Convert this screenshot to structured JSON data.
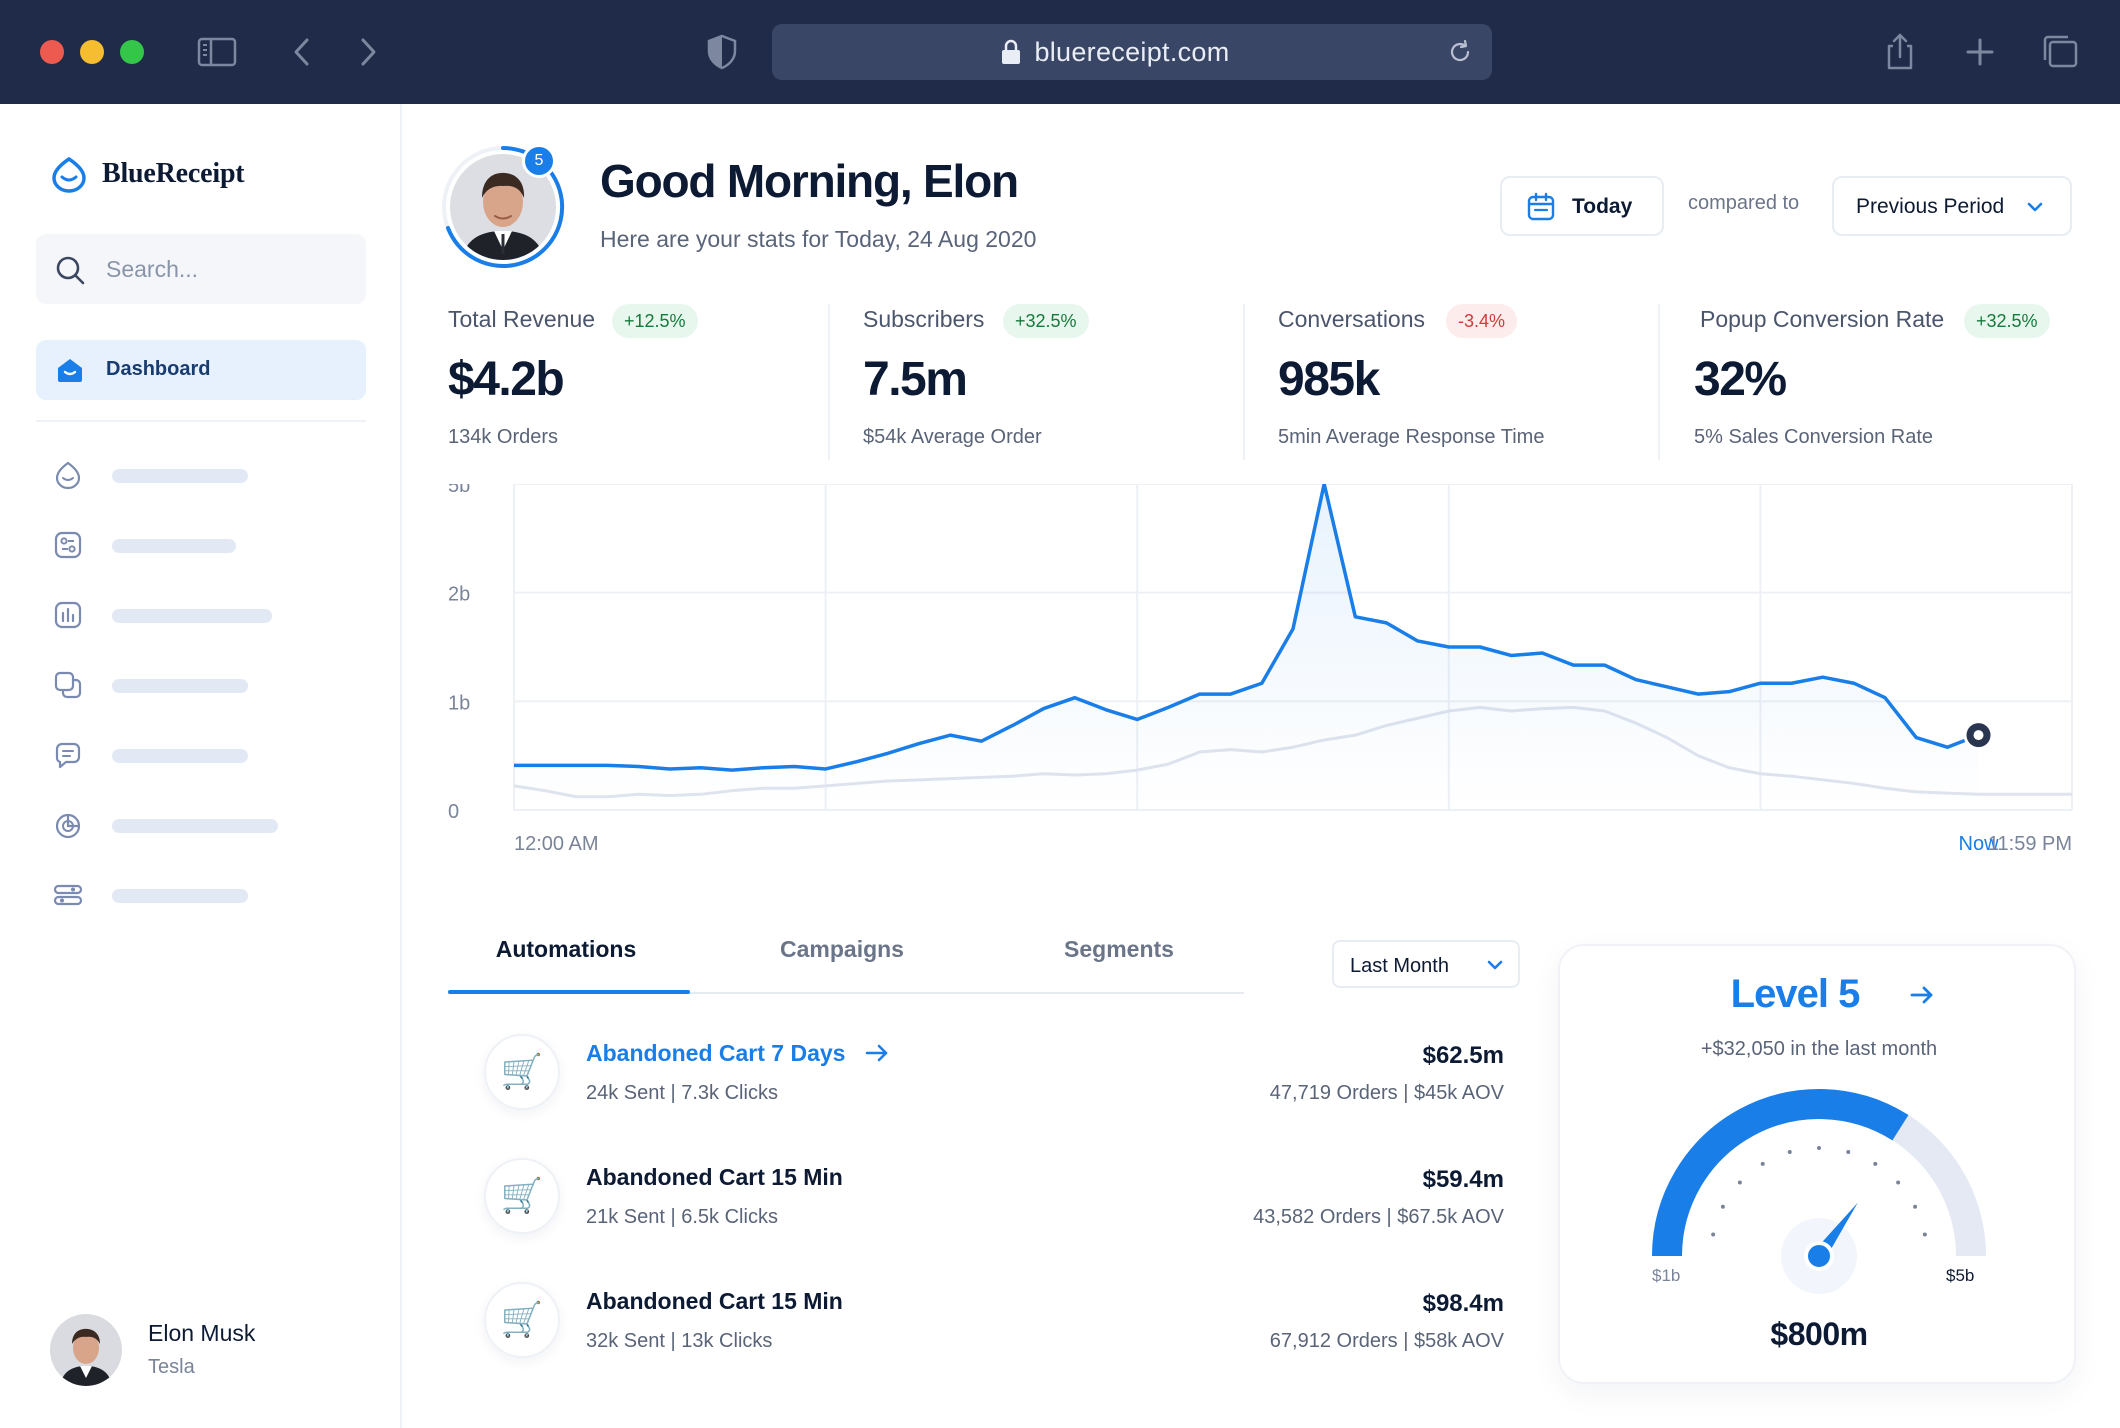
{
  "browser": {
    "url": "bluereceipt.com"
  },
  "brand": {
    "name": "BlueReceipt",
    "accent": "#1a7ee8"
  },
  "sidebar": {
    "search_placeholder": "Search...",
    "active_item": "Dashboard",
    "placeholder_items": [
      {
        "icon": "drop-icon"
      },
      {
        "icon": "apps-icon"
      },
      {
        "icon": "bar-chart-icon"
      },
      {
        "icon": "copy-icon"
      },
      {
        "icon": "message-icon"
      },
      {
        "icon": "pie-chart-icon"
      },
      {
        "icon": "sliders-icon"
      }
    ],
    "profile": {
      "name": "Elon Musk",
      "company": "Tesla"
    }
  },
  "header": {
    "greeting": "Good Morning, Elon",
    "subtitle": "Here are your stats for Today, 24 Aug 2020",
    "notification_count": "5",
    "today_label": "Today",
    "compared_to": "compared to",
    "period": "Previous Period"
  },
  "stats": [
    {
      "label": "Total Revenue",
      "change": "+12.5%",
      "trend": "up",
      "value": "$4.2b",
      "sub": "134k Orders"
    },
    {
      "label": "Subscribers",
      "change": "+32.5%",
      "trend": "up",
      "value": "7.5m",
      "sub": "$54k Average Order"
    },
    {
      "label": "Conversations",
      "change": "-3.4%",
      "trend": "down",
      "value": "985k",
      "sub": "5min Average Response Time"
    },
    {
      "label": "Popup Conversion Rate",
      "change": "+32.5%",
      "trend": "up",
      "value": "32%",
      "sub": "5% Sales Conversion Rate"
    }
  ],
  "chart_data": {
    "type": "line",
    "y_ticks": [
      "5b",
      "2b",
      "1b",
      "0"
    ],
    "x_ticks": [
      "12:00 AM",
      "Now",
      "11:59 PM"
    ],
    "grid": true,
    "x": [
      0,
      1,
      2,
      3,
      4,
      5,
      6,
      7,
      8,
      9,
      10,
      11,
      12,
      13,
      14,
      15,
      16,
      17,
      18,
      19,
      20,
      21,
      22,
      23,
      24,
      25,
      26,
      27,
      28,
      29,
      30,
      31,
      32,
      33,
      34,
      35,
      36,
      37,
      38,
      39,
      40,
      41,
      42,
      43,
      44,
      45,
      46,
      47,
      48,
      49,
      50
    ],
    "series": [
      {
        "role": "current",
        "color": "#1a7ee8",
        "values": [
          0.37,
          0.37,
          0.37,
          0.37,
          0.36,
          0.34,
          0.35,
          0.33,
          0.35,
          0.36,
          0.34,
          0.4,
          0.47,
          0.55,
          0.62,
          0.57,
          0.7,
          0.84,
          0.93,
          0.83,
          0.75,
          0.85,
          0.96,
          0.96,
          1.05,
          1.5,
          2.7,
          1.6,
          1.55,
          1.4,
          1.35,
          1.35,
          1.28,
          1.3,
          1.2,
          1.2,
          1.08,
          1.02,
          0.96,
          0.98,
          1.05,
          1.05,
          1.1,
          1.05,
          0.93,
          0.6,
          0.52,
          0.62,
          null,
          null,
          null
        ]
      },
      {
        "role": "previous",
        "color": "#dfe4ee",
        "values": [
          0.2,
          0.16,
          0.11,
          0.11,
          0.13,
          0.12,
          0.13,
          0.16,
          0.18,
          0.18,
          0.2,
          0.22,
          0.24,
          0.25,
          0.26,
          0.27,
          0.28,
          0.3,
          0.29,
          0.3,
          0.33,
          0.38,
          0.48,
          0.5,
          0.48,
          0.52,
          0.58,
          0.62,
          0.7,
          0.76,
          0.82,
          0.85,
          0.82,
          0.84,
          0.85,
          0.82,
          0.72,
          0.6,
          0.45,
          0.35,
          0.3,
          0.28,
          0.25,
          0.22,
          0.18,
          0.15,
          0.14,
          0.13,
          0.13,
          0.13,
          0.13
        ]
      }
    ],
    "now_marker_value": 0.62
  },
  "tabs": {
    "items": [
      "Automations",
      "Campaigns",
      "Segments"
    ],
    "active": "Automations",
    "filter": "Last Month"
  },
  "automations": [
    {
      "title": "Abandoned Cart 7 Days",
      "highlighted": true,
      "stats": "24k Sent | 7.3k Clicks",
      "amount": "$62.5m",
      "orders": "47,719 Orders | $45k AOV"
    },
    {
      "title": "Abandoned Cart 15 Min",
      "highlighted": false,
      "stats": "21k Sent | 6.5k Clicks",
      "amount": "$59.4m",
      "orders": "43,582 Orders | $67.5k AOV"
    },
    {
      "title": "Abandoned Cart 15 Min",
      "highlighted": false,
      "stats": "32k Sent | 13k Clicks",
      "amount": "$98.4m",
      "orders": "67,912 Orders | $58k AOV"
    }
  ],
  "level": {
    "title": "Level 5",
    "subtitle": "+$32,050 in the last month",
    "gauge_min": "$1b",
    "gauge_max": "$5b",
    "value": "$800m",
    "gauge_fraction": 0.68
  }
}
